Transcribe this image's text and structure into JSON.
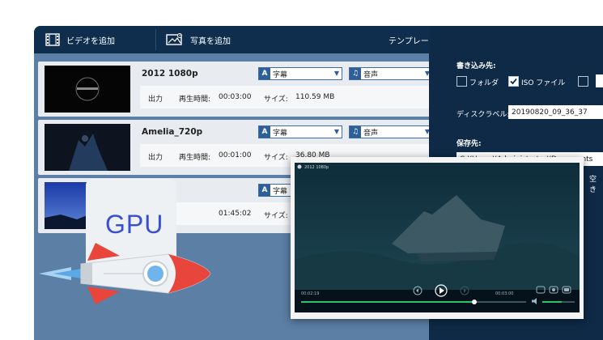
{
  "toolbar": {
    "add_video": "ビデオを追加",
    "add_photo": "写真を追加",
    "template": "テンプレート"
  },
  "labels": {
    "output": "出力",
    "duration": "再生時間:",
    "size": "サイズ:"
  },
  "videos": [
    {
      "title": "2012 1080p",
      "subtitle": "字幕",
      "audio": "音声",
      "duration": "00:03:00",
      "size": "110.59 MB"
    },
    {
      "title": "Amelia_720p",
      "subtitle": "字幕",
      "audio": "音声",
      "duration": "00:01:00",
      "size": "36.80 MB"
    },
    {
      "title": "",
      "subtitle": "字幕",
      "audio": "",
      "duration": "01:45:02",
      "size": ""
    }
  ],
  "panel": {
    "burn_to": "書き込み先:",
    "folder": "フォルダ",
    "iso": "ISO ファイル",
    "disc_label": "ディスクラベル:",
    "disc_label_value": "20190820_09_36_37",
    "save_to": "保存先:",
    "save_path": "C:¥Users¥Administrator¥Documents",
    "free_space": "空き"
  },
  "player": {
    "time_current": "00:02:19",
    "time_total": "00:03:00",
    "progress": 0.77,
    "volume": 0.6,
    "tab_label": "2012 1080p"
  },
  "overlay": {
    "gpu": "GPU"
  },
  "colors": {
    "toolbar": "#0f2d4d",
    "panel": "#0e2a47",
    "accent": "#2e5f98",
    "gpu_text": "#3a4fd0",
    "progress": "#29c36a"
  }
}
